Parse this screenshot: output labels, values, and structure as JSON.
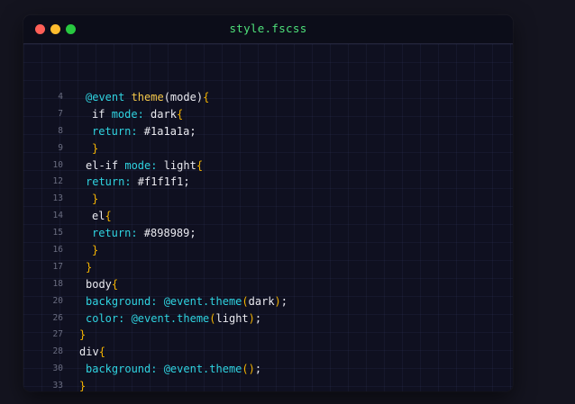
{
  "window": {
    "title": "style.fscss"
  },
  "colors": {
    "keyword": "#2fd3e0",
    "function": "#f5c84a",
    "bracket": "#f5b400",
    "plain": "#eaeaf0",
    "line_number": "#6a6d80",
    "title": "#4ee07a"
  },
  "code": [
    {
      "n": "4",
      "indent": 1,
      "tokens": [
        {
          "t": "@event ",
          "c": "kw"
        },
        {
          "t": "theme",
          "c": "fn"
        },
        {
          "t": "(mode)",
          "c": "pl"
        },
        {
          "t": "{",
          "c": "br"
        }
      ]
    },
    {
      "n": "7",
      "indent": 2,
      "tokens": [
        {
          "t": "if ",
          "c": "pl"
        },
        {
          "t": "mode:",
          "c": "kw"
        },
        {
          "t": " dark",
          "c": "pl"
        },
        {
          "t": "{",
          "c": "br"
        }
      ]
    },
    {
      "n": "8",
      "indent": 2,
      "tokens": [
        {
          "t": "return:",
          "c": "kw"
        },
        {
          "t": " #1a1a1a;",
          "c": "pl"
        }
      ]
    },
    {
      "n": "9",
      "indent": 2,
      "tokens": [
        {
          "t": "}",
          "c": "br"
        }
      ]
    },
    {
      "n": "10",
      "indent": 1,
      "tokens": [
        {
          "t": "el-if ",
          "c": "pl"
        },
        {
          "t": "mode:",
          "c": "kw"
        },
        {
          "t": " light",
          "c": "pl"
        },
        {
          "t": "{",
          "c": "br"
        }
      ]
    },
    {
      "n": "12",
      "indent": 1,
      "tokens": [
        {
          "t": "return:",
          "c": "kw"
        },
        {
          "t": " #f1f1f1;",
          "c": "pl"
        }
      ]
    },
    {
      "n": "13",
      "indent": 2,
      "tokens": [
        {
          "t": "}",
          "c": "br"
        }
      ]
    },
    {
      "n": "14",
      "indent": 2,
      "tokens": [
        {
          "t": "el",
          "c": "pl"
        },
        {
          "t": "{",
          "c": "br"
        }
      ]
    },
    {
      "n": "15",
      "indent": 2,
      "tokens": [
        {
          "t": "return:",
          "c": "kw"
        },
        {
          "t": " #898989;",
          "c": "pl"
        }
      ]
    },
    {
      "n": "16",
      "indent": 2,
      "tokens": [
        {
          "t": "}",
          "c": "br"
        }
      ]
    },
    {
      "n": "17",
      "indent": 1,
      "tokens": [
        {
          "t": "}",
          "c": "br"
        }
      ]
    },
    {
      "n": "18",
      "indent": 1,
      "tokens": [
        {
          "t": "body",
          "c": "pl"
        },
        {
          "t": "{",
          "c": "br"
        }
      ]
    },
    {
      "n": "20",
      "indent": 1,
      "tokens": [
        {
          "t": "background:",
          "c": "kw"
        },
        {
          "t": " @event.",
          "c": "kw"
        },
        {
          "t": "theme",
          "c": "kw"
        },
        {
          "t": "(",
          "c": "br"
        },
        {
          "t": "dark",
          "c": "pl"
        },
        {
          "t": ")",
          "c": "br"
        },
        {
          "t": ";",
          "c": "pl"
        }
      ]
    },
    {
      "n": "26",
      "indent": 1,
      "tokens": [
        {
          "t": "color:",
          "c": "kw"
        },
        {
          "t": " @event.",
          "c": "kw"
        },
        {
          "t": "theme",
          "c": "kw"
        },
        {
          "t": "(",
          "c": "br"
        },
        {
          "t": "light",
          "c": "pl"
        },
        {
          "t": ")",
          "c": "br"
        },
        {
          "t": ";",
          "c": "pl"
        }
      ]
    },
    {
      "n": "27",
      "indent": 0,
      "tokens": [
        {
          "t": "}",
          "c": "br"
        }
      ]
    },
    {
      "n": "28",
      "indent": 0,
      "tokens": [
        {
          "t": "div",
          "c": "pl"
        },
        {
          "t": "{",
          "c": "br"
        }
      ]
    },
    {
      "n": "30",
      "indent": 1,
      "tokens": [
        {
          "t": "background:",
          "c": "kw"
        },
        {
          "t": " @event.",
          "c": "kw"
        },
        {
          "t": "theme",
          "c": "kw"
        },
        {
          "t": "()",
          "c": "br"
        },
        {
          "t": ";",
          "c": "pl"
        }
      ]
    },
    {
      "n": "33",
      "indent": 0,
      "tokens": [
        {
          "t": "}",
          "c": "br"
        }
      ]
    }
  ]
}
